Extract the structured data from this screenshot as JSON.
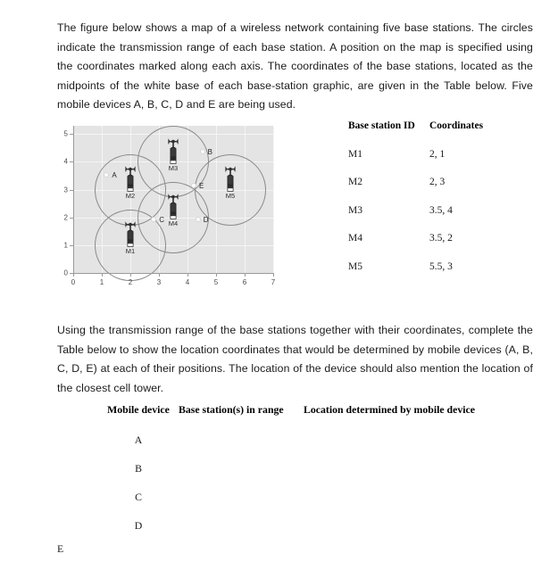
{
  "intro_paragraph": "The figure below shows a map of a wireless network containing five base stations. The circles indicate the transmission range of each base station. A position on the map is specified using the coordinates marked along each axis. The coordinates of the base stations, located as the midpoints of the white base of each base-station graphic, are given in the Table below. Five mobile devices A, B, C, D and E are being used.",
  "task_paragraph": "Using the transmission range of the base stations together with their coordinates, complete the Table below to show the location coordinates that would be determined by mobile devices (A, B, C, D, E) at each of their positions. The location of the device should also mention the location of the closest cell tower.",
  "coord_table": {
    "headers": {
      "id": "Base station ID",
      "coords": "Coordinates"
    },
    "rows": [
      {
        "id": "M1",
        "coords": "2, 1"
      },
      {
        "id": "M2",
        "coords": "2, 3"
      },
      {
        "id": "M3",
        "coords": "3.5, 4"
      },
      {
        "id": "M4",
        "coords": "3.5, 2"
      },
      {
        "id": "M5",
        "coords": "5.5, 3"
      }
    ]
  },
  "answer_table": {
    "headers": {
      "device": "Mobile device",
      "in_range": "Base station(s) in range",
      "location": "Location determined by mobile device"
    },
    "rows": [
      {
        "device": "A",
        "in_range": "",
        "location": ""
      },
      {
        "device": "B",
        "in_range": "",
        "location": ""
      },
      {
        "device": "C",
        "in_range": "",
        "location": ""
      },
      {
        "device": "D",
        "in_range": "",
        "location": ""
      }
    ],
    "orphan_row": {
      "device": "E"
    }
  },
  "chart_data": {
    "type": "scatter",
    "title": "",
    "xlabel": "",
    "ylabel": "",
    "xlim": [
      0,
      7
    ],
    "ylim": [
      0,
      5.3
    ],
    "xticks": [
      "0",
      "1",
      "2",
      "3",
      "4",
      "5",
      "6",
      "7"
    ],
    "yticks": [
      "0",
      "1",
      "2",
      "3",
      "4",
      "5"
    ],
    "grid": true,
    "plot_background": "#e4e4e4",
    "gridline_color": "#f4f4f4",
    "circle_color": "#8a8a8a",
    "transmission_radius": 1.25,
    "base_stations": [
      {
        "id": "M1",
        "x": 2,
        "y": 1,
        "radius": 1.25
      },
      {
        "id": "M2",
        "x": 2,
        "y": 3,
        "radius": 1.25
      },
      {
        "id": "M3",
        "x": 3.5,
        "y": 4,
        "radius": 1.25
      },
      {
        "id": "M4",
        "x": 3.5,
        "y": 2,
        "radius": 1.25
      },
      {
        "id": "M5",
        "x": 5.5,
        "y": 3,
        "radius": 1.25
      }
    ],
    "mobile_devices": [
      {
        "id": "A",
        "x": 1.2,
        "y": 3.5
      },
      {
        "id": "B",
        "x": 4.55,
        "y": 4.35
      },
      {
        "id": "C",
        "x": 2.85,
        "y": 1.88
      },
      {
        "id": "D",
        "x": 4.4,
        "y": 1.9
      },
      {
        "id": "E",
        "x": 4.25,
        "y": 3.1
      }
    ]
  }
}
